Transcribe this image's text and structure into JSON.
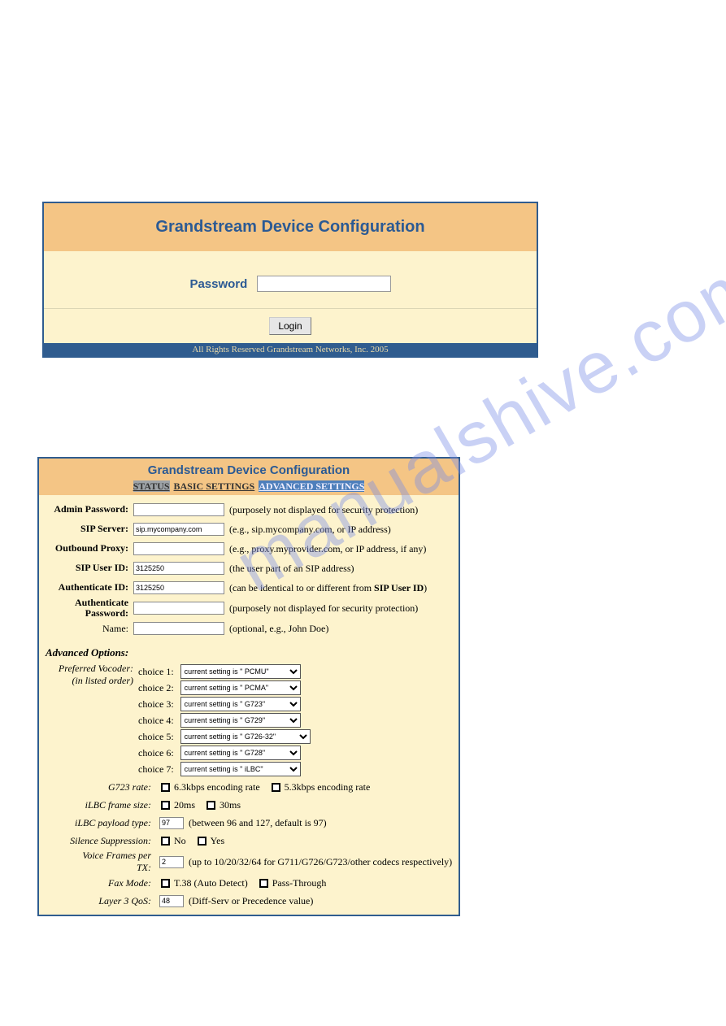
{
  "watermark": "manualshive.com",
  "login": {
    "title": "Grandstream Device Configuration",
    "password_label": "Password",
    "button": "Login",
    "footer": "All Rights Reserved Grandstream Networks, Inc. 2005"
  },
  "config": {
    "title": "Grandstream Device Configuration",
    "tabs": {
      "status": "STATUS",
      "basic": "BASIC SETTINGS",
      "advanced": "ADVANCED SETTINGS"
    },
    "fields": {
      "admin_password": {
        "label": "Admin Password:",
        "value": "",
        "hint": "(purposely not displayed for security protection)"
      },
      "sip_server": {
        "label": "SIP Server:",
        "value": "sip.mycompany.com",
        "hint": "(e.g., sip.mycompany.com, or IP address)"
      },
      "outbound_proxy": {
        "label": "Outbound Proxy:",
        "value": "",
        "hint": "(e.g., proxy.myprovider.com, or IP address, if any)"
      },
      "sip_user_id": {
        "label": "SIP User ID:",
        "value": "3125250",
        "hint": "(the user part of an SIP address)"
      },
      "authenticate_id": {
        "label": "Authenticate ID:",
        "value": "3125250",
        "hint_prefix": "(can be identical to or different from ",
        "hint_bold": "SIP User ID",
        "hint_suffix": ")"
      },
      "auth_password": {
        "label1": "Authenticate",
        "label2": "Password:",
        "value": "",
        "hint": "(purposely not displayed for security protection)"
      },
      "name": {
        "label": "Name:",
        "value": "",
        "hint": "(optional, e.g., John Doe)"
      }
    },
    "advanced_heading": "Advanced Options:",
    "vocoder": {
      "label1": "Preferred Vocoder:",
      "label2": "(in listed order)",
      "choices": [
        {
          "label": "choice 1:",
          "value": "current setting is \" PCMU\""
        },
        {
          "label": "choice 2:",
          "value": "current setting is \" PCMA\""
        },
        {
          "label": "choice 3:",
          "value": "current setting is \" G723\""
        },
        {
          "label": "choice 4:",
          "value": "current setting is \" G729\""
        },
        {
          "label": "choice 5:",
          "value": "current setting is \" G726-32\""
        },
        {
          "label": "choice 6:",
          "value": "current setting is \" G728\""
        },
        {
          "label": "choice 7:",
          "value": "current setting is \" iLBC\""
        }
      ]
    },
    "g723": {
      "label": "G723 rate:",
      "opt1": "6.3kbps encoding rate",
      "opt2": "5.3kbps encoding rate"
    },
    "ilbc_frame": {
      "label": "iLBC frame size:",
      "opt1": "20ms",
      "opt2": "30ms"
    },
    "ilbc_payload": {
      "label": "iLBC payload type:",
      "value": "97",
      "hint": "(between 96 and 127, default is 97)"
    },
    "silence": {
      "label": "Silence Suppression:",
      "opt1": "No",
      "opt2": "Yes"
    },
    "voice_frames": {
      "label1": "Voice Frames per",
      "label2": "TX:",
      "value": "2",
      "hint": "(up to 10/20/32/64 for G711/G726/G723/other codecs respectively)"
    },
    "fax": {
      "label": "Fax Mode:",
      "opt1": "T.38 (Auto Detect)",
      "opt2": "Pass-Through"
    },
    "qos": {
      "label": "Layer 3 QoS:",
      "value": "48",
      "hint": "(Diff-Serv or Precedence value)"
    }
  }
}
